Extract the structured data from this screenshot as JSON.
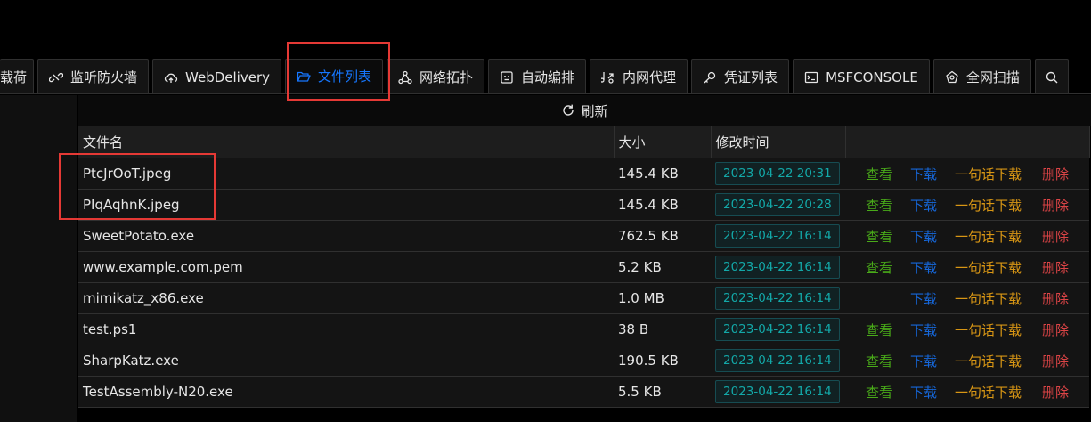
{
  "tabs": [
    {
      "label": "载荷",
      "icon": "payload-icon",
      "partial": true
    },
    {
      "label": "监听防火墙",
      "icon": "link-broken-icon"
    },
    {
      "label": "WebDelivery",
      "icon": "cloud-upload-icon"
    },
    {
      "label": "文件列表",
      "icon": "folder-open-icon",
      "active": true
    },
    {
      "label": "网络拓扑",
      "icon": "network-topology-icon"
    },
    {
      "label": "自动编排",
      "icon": "robot-icon"
    },
    {
      "label": "内网代理",
      "icon": "proxy-icon"
    },
    {
      "label": "凭证列表",
      "icon": "key-icon"
    },
    {
      "label": "MSFCONSOLE",
      "icon": "terminal-icon"
    },
    {
      "label": "全网扫描",
      "icon": "radar-icon"
    }
  ],
  "more_icon": "search-icon",
  "toolbar": {
    "refresh_label": "刷新"
  },
  "table": {
    "headers": {
      "name": "文件名",
      "size": "大小",
      "time": "修改时间",
      "actions": ""
    },
    "actions": {
      "view": "查看",
      "download": "下载",
      "oneliner": "一句话下载",
      "delete": "删除"
    },
    "rows": [
      {
        "name": "PtcJrOoT.jpeg",
        "size": "145.4 KB",
        "time": "2023-04-22 20:31",
        "viewable": true
      },
      {
        "name": "PIqAqhnK.jpeg",
        "size": "145.4 KB",
        "time": "2023-04-22 20:28",
        "viewable": true
      },
      {
        "name": "SweetPotato.exe",
        "size": "762.5 KB",
        "time": "2023-04-22 16:14",
        "viewable": true
      },
      {
        "name": "www.example.com.pem",
        "size": "5.2 KB",
        "time": "2023-04-22 16:14",
        "viewable": true
      },
      {
        "name": "mimikatz_x86.exe",
        "size": "1.0 MB",
        "time": "2023-04-22 16:14",
        "viewable": false
      },
      {
        "name": "test.ps1",
        "size": "38 B",
        "time": "2023-04-22 16:14",
        "viewable": true
      },
      {
        "name": "SharpKatz.exe",
        "size": "190.5 KB",
        "time": "2023-04-22 16:14",
        "viewable": true
      },
      {
        "name": "TestAssembly-N20.exe",
        "size": "5.5 KB",
        "time": "2023-04-22 16:14",
        "viewable": true
      }
    ]
  },
  "colors": {
    "view": "#49aa19",
    "download": "#1668dc",
    "oneliner": "#d89614",
    "delete": "#dc4446",
    "active_tab": "#1677ff",
    "highlight_box": "#e53935"
  }
}
